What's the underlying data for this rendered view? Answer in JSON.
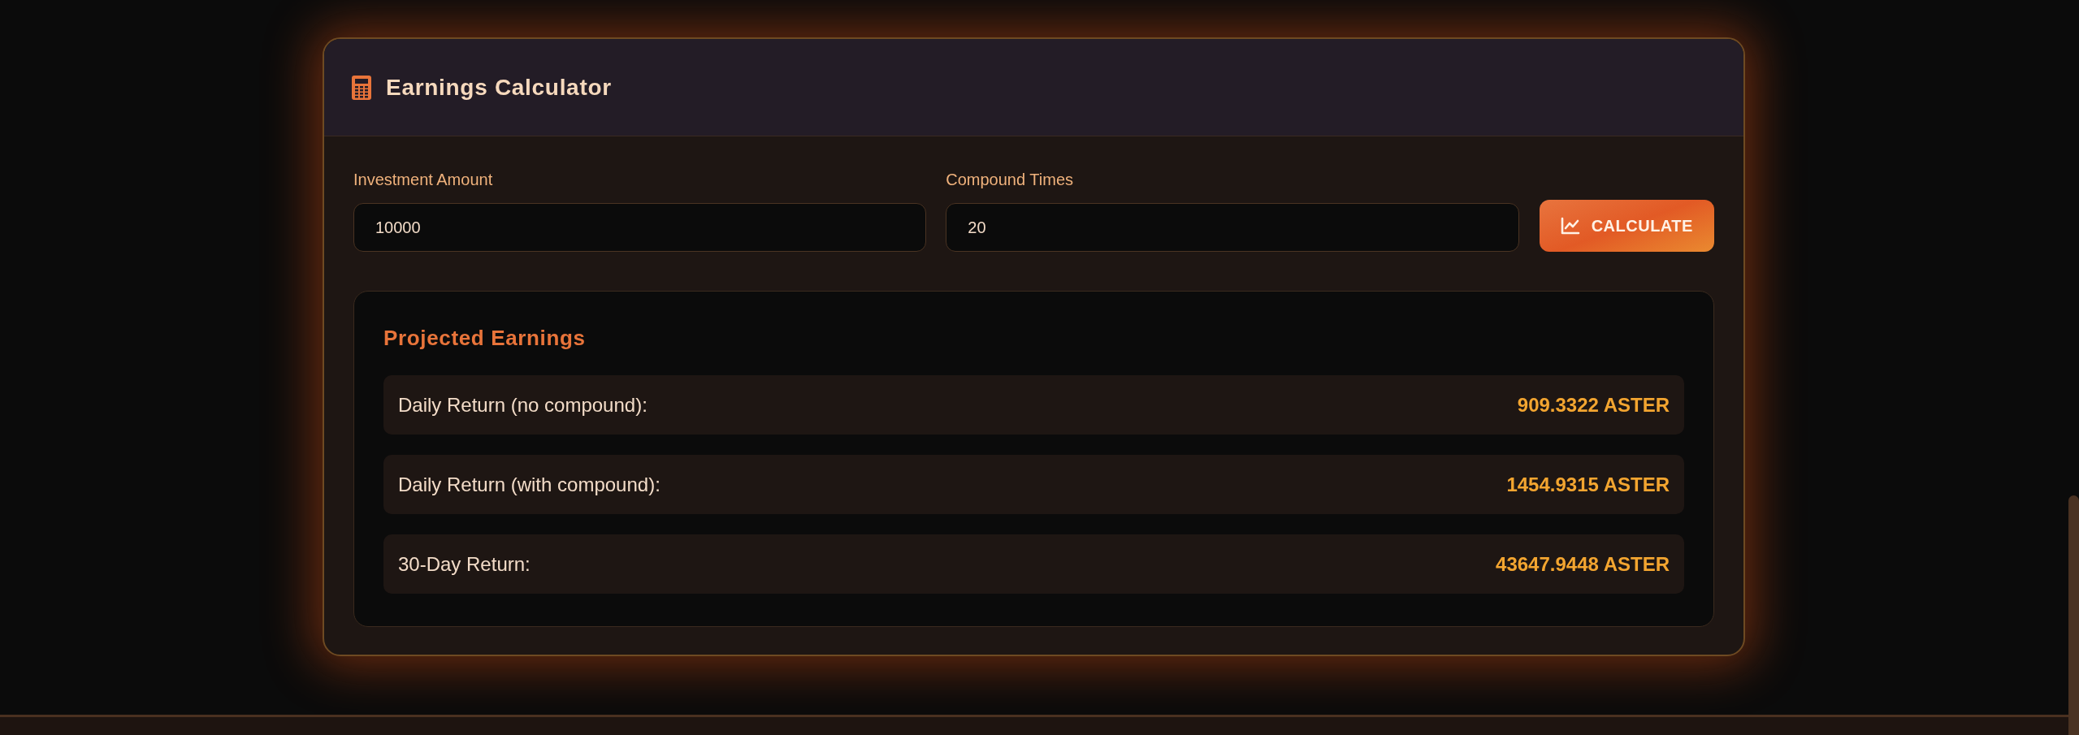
{
  "card": {
    "title": "Earnings Calculator"
  },
  "fields": [
    {
      "label": "Investment Amount",
      "value": "10000"
    },
    {
      "label": "Compound Times",
      "value": "20"
    }
  ],
  "button": {
    "label": "CALCULATE"
  },
  "results": {
    "title": "Projected Earnings",
    "rows": [
      {
        "label": "Daily Return (no compound):",
        "value": "909.3322 ASTER"
      },
      {
        "label": "Daily Return (with compound):",
        "value": "1454.9315 ASTER"
      },
      {
        "label": "30-Day Return:",
        "value": "43647.9448 ASTER"
      }
    ]
  }
}
